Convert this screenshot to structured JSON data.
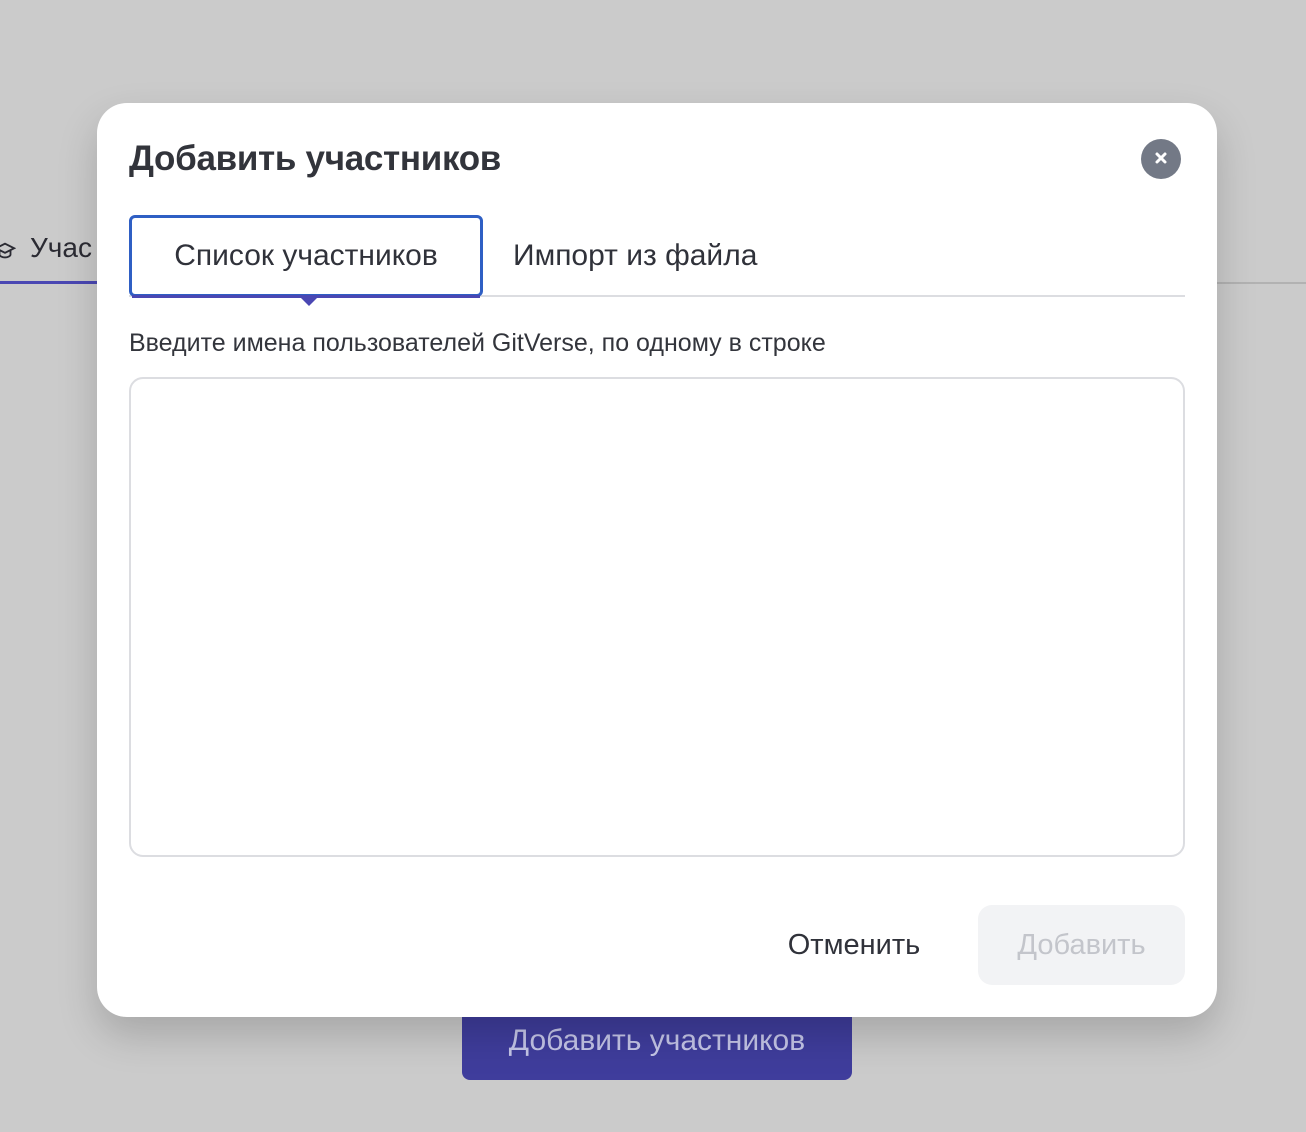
{
  "background": {
    "tab_label": "Учас",
    "tab_icon": "graduation-cap-icon",
    "add_members_label": "Добавить участников"
  },
  "modal": {
    "title": "Добавить участников",
    "close_icon": "close-icon",
    "tabs": [
      {
        "label": "Список участников",
        "active": true
      },
      {
        "label": "Импорт из файла",
        "active": false
      }
    ],
    "field_label": "Введите имена пользователей GitVerse, по одному в строке",
    "textarea_value": "",
    "cancel_label": "Отменить",
    "add_label": "Добавить"
  },
  "colors": {
    "accent": "#4a47b3",
    "focus_border": "#2f5fc4",
    "close_bg": "#737986",
    "disabled_bg": "#f2f3f5",
    "disabled_text": "#c3c5cb"
  }
}
